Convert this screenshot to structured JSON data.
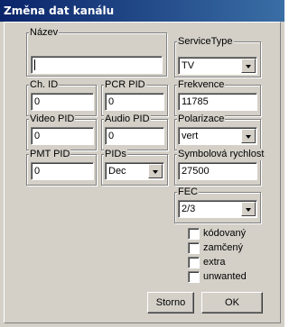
{
  "window": {
    "title": "Změna dat kanálu"
  },
  "fields": {
    "nazev": {
      "label": "Název",
      "value": ""
    },
    "service_type": {
      "label": "ServiceType",
      "value": "TV"
    },
    "ch_id": {
      "label": "Ch. ID",
      "value": "0"
    },
    "pcr_pid": {
      "label": "PCR PID",
      "value": "0"
    },
    "frekvence": {
      "label": "Frekvence",
      "value": "11785"
    },
    "video_pid": {
      "label": "Video PID",
      "value": "0"
    },
    "audio_pid": {
      "label": "Audio PID",
      "value": "0"
    },
    "polarizace": {
      "label": "Polarizace",
      "value": "vert"
    },
    "pmt_pid": {
      "label": "PMT PID",
      "value": "0"
    },
    "pids": {
      "label": "PIDs",
      "value": "Dec"
    },
    "symbol_rate": {
      "label": "Symbolová rychlost",
      "value": "27500"
    },
    "fec": {
      "label": "FEC",
      "value": "2/3"
    }
  },
  "checkboxes": [
    {
      "label": "kódovaný",
      "checked": false
    },
    {
      "label": "zamčený",
      "checked": false
    },
    {
      "label": "extra",
      "checked": false
    },
    {
      "label": "unwanted",
      "checked": false
    }
  ],
  "buttons": {
    "cancel": "Storno",
    "ok": "OK"
  }
}
